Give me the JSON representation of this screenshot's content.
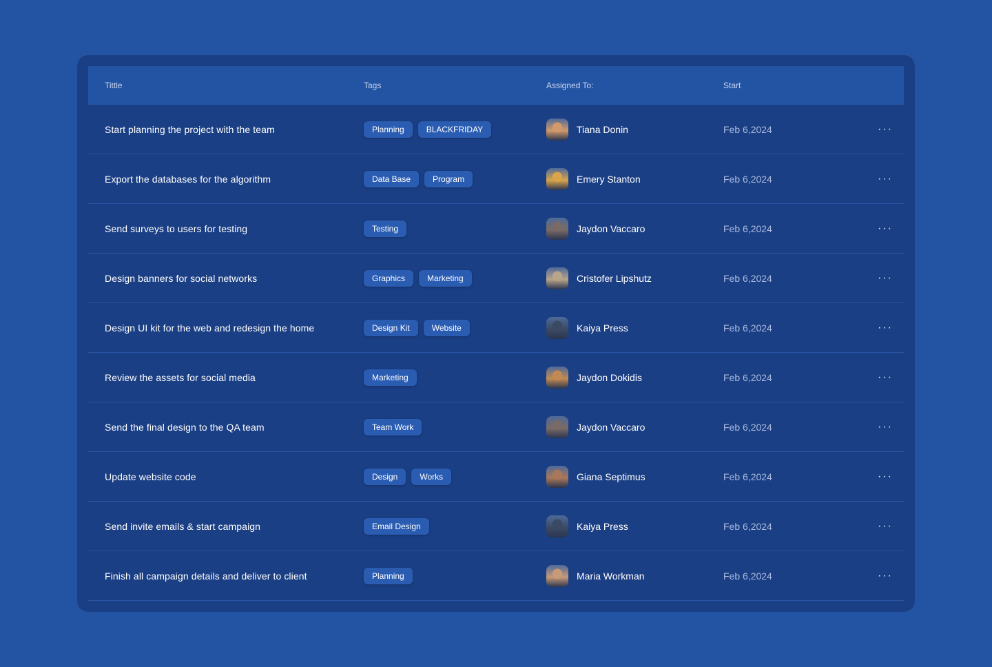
{
  "header": {
    "title": "Tittle",
    "tags": "Tags",
    "assigned": "Assigned To:",
    "start": "Start"
  },
  "rows": [
    {
      "title": "Start planning the project with the team",
      "tags": [
        "Planning",
        "BLACKFRIDAY"
      ],
      "assignee": "Tiana Donin",
      "start": "Feb 6,2024",
      "avatar_color": "#d29a6a"
    },
    {
      "title": "Export the databases for the algorithm",
      "tags": [
        "Data Base",
        "Program"
      ],
      "assignee": "Emery Stanton",
      "start": "Feb 6,2024",
      "avatar_color": "#d9a44a"
    },
    {
      "title": "Send surveys to users for testing",
      "tags": [
        "Testing"
      ],
      "assignee": "Jaydon Vaccaro",
      "start": "Feb 6,2024",
      "avatar_color": "#7a6a66"
    },
    {
      "title": "Design banners for social networks",
      "tags": [
        "Graphics",
        "Marketing"
      ],
      "assignee": "Cristofer Lipshutz",
      "start": "Feb 6,2024",
      "avatar_color": "#b9a48a"
    },
    {
      "title": "Design UI kit for the web and redesign the home",
      "tags": [
        "Design Kit",
        "Website"
      ],
      "assignee": "Kaiya Press",
      "start": "Feb 6,2024",
      "avatar_color": "#3b4a63"
    },
    {
      "title": "Review the assets for social media",
      "tags": [
        "Marketing"
      ],
      "assignee": "Jaydon Dokidis",
      "start": "Feb 6,2024",
      "avatar_color": "#c28a52"
    },
    {
      "title": "Send the final design to the QA team",
      "tags": [
        "Team Work"
      ],
      "assignee": "Jaydon Vaccaro",
      "start": "Feb 6,2024",
      "avatar_color": "#7a6a66"
    },
    {
      "title": "Update website code",
      "tags": [
        "Design",
        "Works"
      ],
      "assignee": "Giana Septimus",
      "start": "Feb 6,2024",
      "avatar_color": "#a9785a"
    },
    {
      "title": "Send invite emails & start campaign",
      "tags": [
        "Email Design"
      ],
      "assignee": "Kaiya Press",
      "start": "Feb 6,2024",
      "avatar_color": "#3b4a63"
    },
    {
      "title": "Finish all campaign details and deliver to client",
      "tags": [
        "Planning"
      ],
      "assignee": "Maria Workman",
      "start": "Feb 6,2024",
      "avatar_color": "#c79a78"
    }
  ],
  "colors": {
    "background": "#2354a4",
    "card": "#1b3f84",
    "header": "#2354a4",
    "tag": "#2a5cb2",
    "date_text": "#aabbe0"
  },
  "icons": {
    "row_action": "more-horizontal-icon",
    "avatar": "user-avatar-icon"
  }
}
